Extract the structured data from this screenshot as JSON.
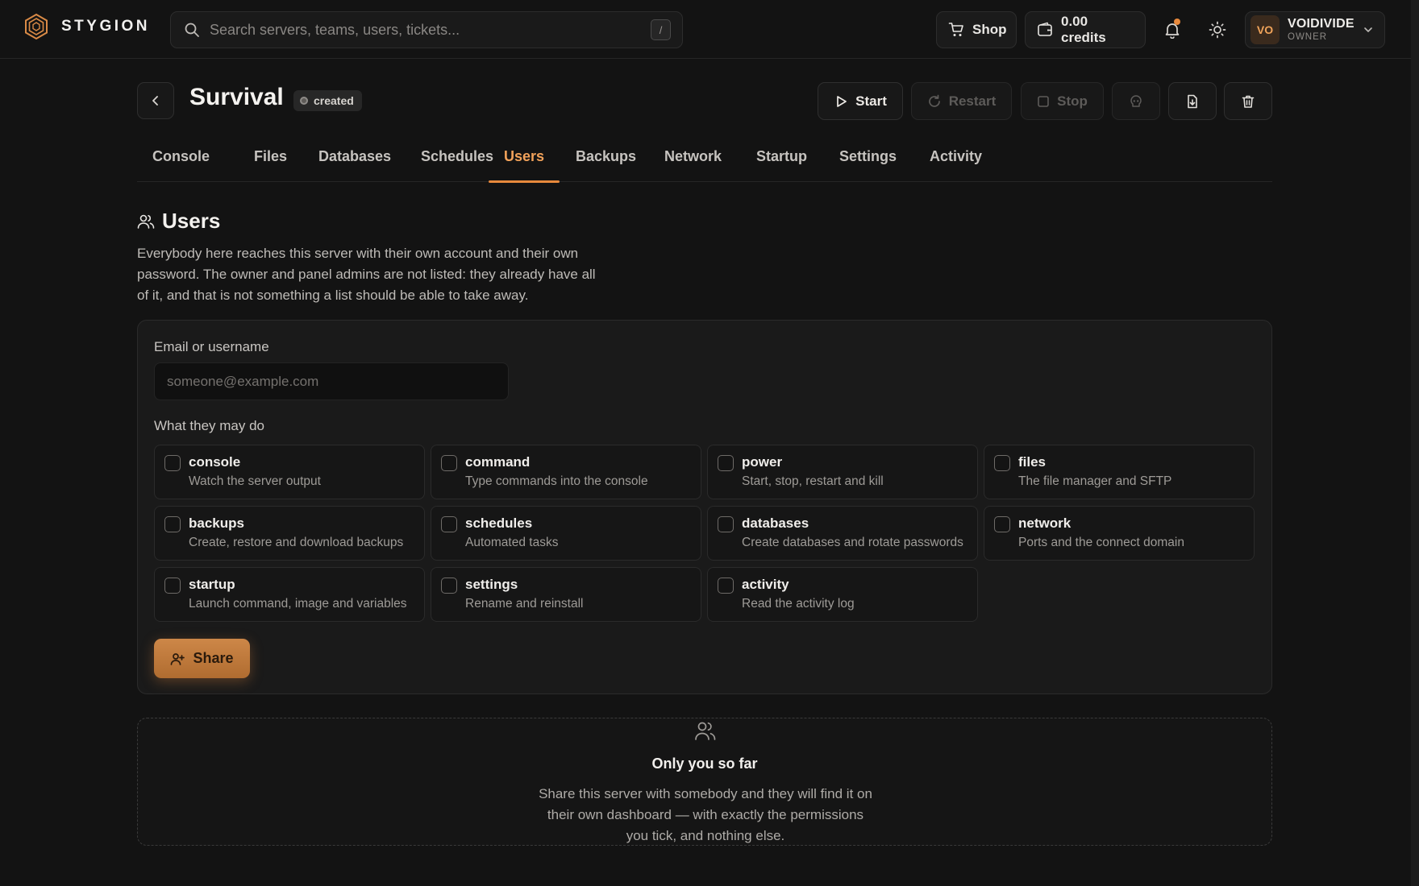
{
  "app": {
    "brand": "STYGION",
    "search_placeholder": "Search servers, teams, users, tickets...",
    "search_shortcut": "/",
    "shop_label": "Shop",
    "credits_label": "0.00 credits",
    "user": {
      "initials": "VO",
      "name": "VOIDIVIDE",
      "role": "OWNER"
    },
    "accent_color": "#e8893c"
  },
  "server": {
    "name": "Survival",
    "status": "created",
    "actions": {
      "start": "Start",
      "restart": "Restart",
      "stop": "Stop"
    }
  },
  "tabs": [
    {
      "label": "Console"
    },
    {
      "label": "Files"
    },
    {
      "label": "Databases"
    },
    {
      "label": "Schedules"
    },
    {
      "label": "Users",
      "active": true
    },
    {
      "label": "Backups"
    },
    {
      "label": "Network"
    },
    {
      "label": "Startup"
    },
    {
      "label": "Settings"
    },
    {
      "label": "Activity"
    }
  ],
  "users": {
    "title": "Users",
    "description": "Everybody here reaches this server with their own account and their own password. The owner and panel admins are not listed: they already have all of it, and that is not something a list should be able to take away.",
    "form": {
      "email_label": "Email or username",
      "email_placeholder": "someone@example.com",
      "permissions_label": "What they may do",
      "permissions": [
        {
          "name": "console",
          "desc": "Watch the server output",
          "checked": false
        },
        {
          "name": "command",
          "desc": "Type commands into the console",
          "checked": false
        },
        {
          "name": "power",
          "desc": "Start, stop, restart and kill",
          "checked": false
        },
        {
          "name": "files",
          "desc": "The file manager and SFTP",
          "checked": false
        },
        {
          "name": "backups",
          "desc": "Create, restore and download backups",
          "checked": false
        },
        {
          "name": "schedules",
          "desc": "Automated tasks",
          "checked": false
        },
        {
          "name": "databases",
          "desc": "Create databases and rotate passwords",
          "checked": false
        },
        {
          "name": "network",
          "desc": "Ports and the connect domain",
          "checked": false
        },
        {
          "name": "startup",
          "desc": "Launch command, image and variables",
          "checked": false
        },
        {
          "name": "settings",
          "desc": "Rename and reinstall",
          "checked": false
        },
        {
          "name": "activity",
          "desc": "Read the activity log",
          "checked": false
        }
      ],
      "share_label": "Share"
    },
    "empty": {
      "title": "Only you so far",
      "description": "Share this server with somebody and they will find it on their own dashboard — with exactly the permissions you tick, and nothing else."
    }
  }
}
